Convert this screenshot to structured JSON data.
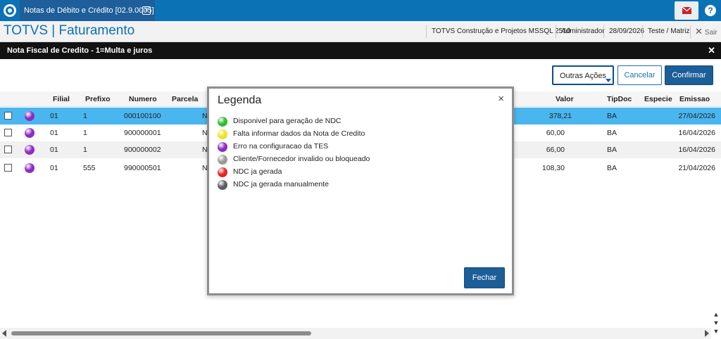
{
  "tab": {
    "title": "Notas de Débito e Crédito [02.9.0005]",
    "close_icon": "close-icon"
  },
  "header": {
    "brand": "TOTVS | Faturamento",
    "company": "TOTVS Construção e Projetos MSSQL 2510",
    "user": "Administrador",
    "date": "28/09/2026",
    "branch": "Teste / Matriz",
    "exit_label": "Sair"
  },
  "dialog": {
    "title": "Nota Fiscal de Credito - 1=Multa e juros"
  },
  "toolbar": {
    "other_actions": "Outras Ações",
    "cancel": "Cancelar",
    "confirm": "Confirmar"
  },
  "grid": {
    "columns": [
      "Filial",
      "Prefixo",
      "Numero",
      "Parcela",
      "Valor",
      "TipDoc",
      "Especie",
      "Emissao"
    ],
    "rows": [
      {
        "filial": "01",
        "prefixo": "1",
        "numero": "000100100",
        "parcela": "N",
        "valor": "378,21",
        "tipdoc": "BA",
        "especie": "",
        "emissao": "27/04/2026",
        "status_color": "#8e2bc2"
      },
      {
        "filial": "01",
        "prefixo": "1",
        "numero": "900000001",
        "parcela": "N",
        "valor": "60,00",
        "tipdoc": "BA",
        "especie": "",
        "emissao": "16/04/2026",
        "status_color": "#8e2bc2"
      },
      {
        "filial": "01",
        "prefixo": "1",
        "numero": "900000002",
        "parcela": "N",
        "valor": "66,00",
        "tipdoc": "BA",
        "especie": "",
        "emissao": "16/04/2026",
        "status_color": "#8e2bc2"
      },
      {
        "filial": "01",
        "prefixo": "555",
        "numero": "990000501",
        "parcela": "N",
        "valor": "108,30",
        "tipdoc": "BA",
        "especie": "",
        "emissao": "21/04/2026",
        "status_color": "#8e2bc2"
      }
    ]
  },
  "legend": {
    "title": "Legenda",
    "close_button": "×",
    "items": [
      {
        "label": "Disponivel para geração de NDC",
        "color": "#2ebd2e"
      },
      {
        "label": "Falta informar dados da Nota de Credito",
        "color": "#f2e21f"
      },
      {
        "label": "Erro na configuracao da TES",
        "color": "#8e2bc2"
      },
      {
        "label": "Cliente/Fornecedor invalido ou bloqueado",
        "color": "#9a9a9a"
      },
      {
        "label": "NDC ja gerada",
        "color": "#e52424"
      },
      {
        "label": "NDC ja gerada manualmente",
        "color": "#5c5c5c"
      }
    ],
    "close_label": "Fechar"
  }
}
